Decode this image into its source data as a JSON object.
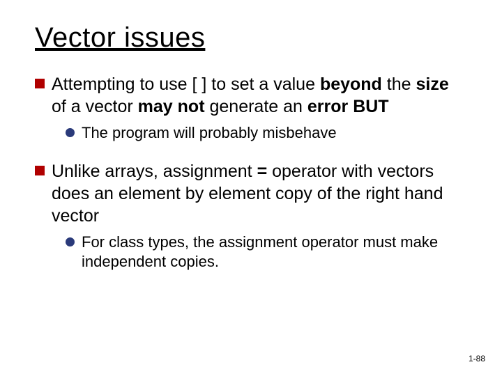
{
  "title": "Vector issues",
  "b1_pre": "Attempting to use [ ] to set a value ",
  "b1_beyond": "beyond",
  "b1_mid1": " the ",
  "b1_size": "size",
  "b1_mid2": " of a vector ",
  "b1_maynot": "may not",
  "b1_mid3": " generate an ",
  "b1_error": "error",
  "b1_sp": " ",
  "b1_but": "BUT",
  "b1_sub": "The program will probably misbehave",
  "b2_pre": "Unlike arrays, assignment ",
  "b2_eq": "=",
  "b2_post": " operator with vectors does an element by element copy of the right hand vector",
  "b2_sub": "For class types, the assignment operator must make independent copies.",
  "pagenum": "1-88"
}
